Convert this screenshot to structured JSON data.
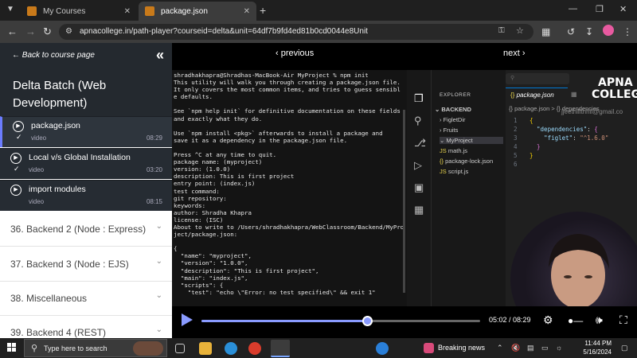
{
  "browser": {
    "tabs": [
      {
        "title": "My Courses",
        "active": false
      },
      {
        "title": "package.json",
        "active": true
      }
    ],
    "url": "apnacollege.in/path-player?courseid=delta&unit=64df7b9fd4ed81b0cd0044e8Unit"
  },
  "sidebar": {
    "back_link": "← Back to course page",
    "course_title": "Delta Batch (Web Development)",
    "lessons": [
      {
        "title": "package.json",
        "type": "video",
        "duration": "08:29",
        "active": true
      },
      {
        "title": "Local v/s Global Installation",
        "type": "video",
        "duration": "03:20",
        "active": false
      },
      {
        "title": "import modules",
        "type": "video",
        "duration": "08:15",
        "active": false
      }
    ],
    "sections": [
      {
        "title": "36. Backend 2 (Node : Express)"
      },
      {
        "title": "37. Backend 3 (Node : EJS)"
      },
      {
        "title": "38. Miscellaneous"
      },
      {
        "title": "39. Backend 4 (REST)"
      }
    ]
  },
  "player": {
    "prev_label": "‹ previous",
    "next_label": "next ›",
    "current_time": "05:02",
    "total_time": "08:29",
    "progress": 0.593,
    "time_display": "05:02 / 08:29"
  },
  "video": {
    "terminal_text": "shradhakhapra@Shradhas-MacBook-Air MyProject % npm init\nThis utility will walk you through creating a package.json file.\nIt only covers the most common items, and tries to guess sensibl\ne defaults.\n\nSee `npm help init` for definitive documentation on these fields\nand exactly what they do.\n\nUse `npm install <pkg>` afterwards to install a package and\nsave it as a dependency in the package.json file.\n\nPress ^C at any time to quit.\npackage name: (myproject)\nversion: (1.0.0)\ndescription: This is first project\nentry point: (index.js)\ntest command:\ngit repository:\nkeywords:\nauthor: Shradha Khapra\nlicense: (ISC)\nAbout to write to /Users/shradhakhapra/WebClassroom/Backend/MyPro\nject/package.json:\n\n{\n  \"name\": \"myproject\",\n  \"version\": \"1.0.0\",\n  \"description\": \"This is first project\",\n  \"main\": \"index.js\",\n  \"scripts\": {\n    \"test\": \"echo \\\"Error: no test specified\\\" && exit 1\"",
    "explorer_header": "EXPLORER",
    "tree": [
      "BACKEND",
      "FigletDir",
      "Fruits",
      "MyProject",
      "math.js",
      "package-lock.json",
      "script.js"
    ],
    "editor_tab": "package.json",
    "editor_breadcrumb": "{} package.json > {} dependencies",
    "code_lines": [
      "1",
      "2",
      "3",
      "4",
      "5",
      "6"
    ],
    "logo_line1": "APNA",
    "logo_line2": "COLLEGE",
    "watermark": "jjeethillthhil@gmail.co"
  },
  "taskbar": {
    "search_placeholder": "Type here to search",
    "news": "Breaking news",
    "time": "11:44 PM",
    "date": "5/16/2024"
  }
}
